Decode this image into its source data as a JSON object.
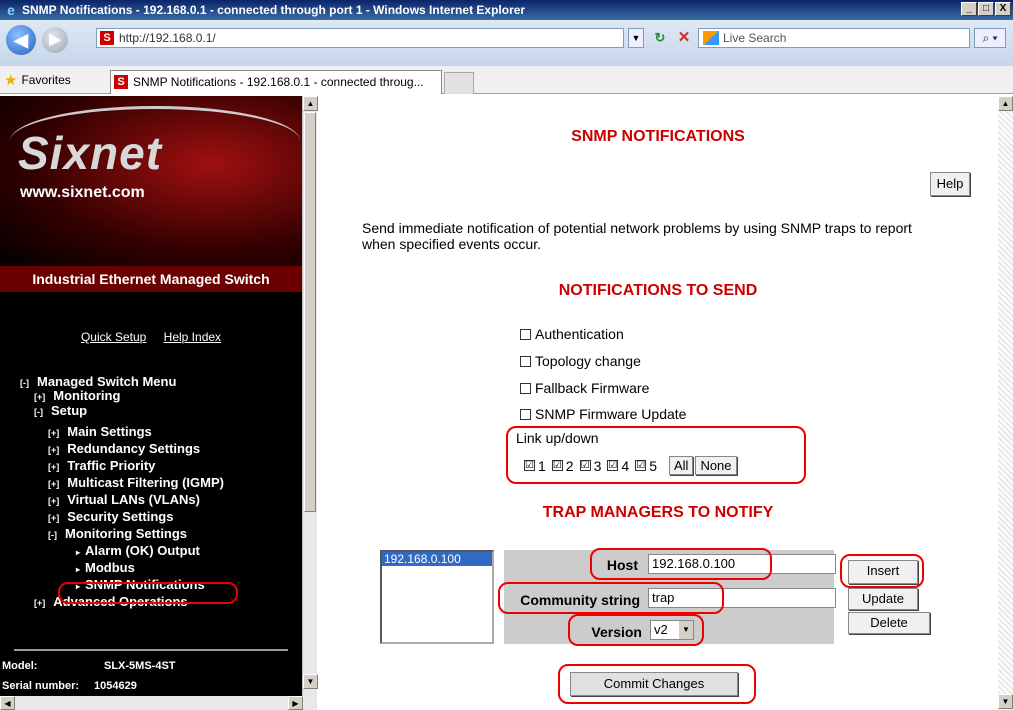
{
  "window": {
    "title": "SNMP Notifications - 192.168.0.1 - connected through port 1 - Windows Internet Explorer",
    "min": "_",
    "max": "□",
    "close": "X"
  },
  "browser": {
    "address": "http://192.168.0.1/",
    "search_placeholder": "Live Search",
    "favorites": "Favorites",
    "tab": "SNMP Notifications - 192.168.0.1 - connected throug..."
  },
  "sidebar": {
    "logo": "Sixnet",
    "url": "www.sixnet.com",
    "product": "Industrial Ethernet Managed Switch",
    "quick_setup": "Quick Setup",
    "help_index": "Help Index",
    "menu": [
      {
        "tog": "[-]",
        "label": "Managed Switch Menu"
      },
      {
        "tog": "[+]",
        "label": "Monitoring"
      },
      {
        "tog": "[-]",
        "label": "Setup"
      },
      {
        "tog": "[+]",
        "label": "Main Settings"
      },
      {
        "tog": "[+]",
        "label": "Redundancy Settings"
      },
      {
        "tog": "[+]",
        "label": "Traffic Priority"
      },
      {
        "tog": "[+]",
        "label": "Multicast Filtering (IGMP)"
      },
      {
        "tog": "[+]",
        "label": "Virtual LANs (VLANs)"
      },
      {
        "tog": "[+]",
        "label": "Security Settings"
      },
      {
        "tog": "[-]",
        "label": "Monitoring Settings"
      },
      {
        "tog": "▸",
        "label": "Alarm (OK) Output"
      },
      {
        "tog": "▸",
        "label": "Modbus"
      },
      {
        "tog": "▸",
        "label": "SNMP Notifications"
      },
      {
        "tog": "[+]",
        "label": "Advanced Operations"
      }
    ],
    "model_label": "Model:",
    "model": "SLX-5MS-4ST",
    "serial_label": "Serial number:",
    "serial": "1054629"
  },
  "main": {
    "title": "SNMP NOTIFICATIONS",
    "help": "Help",
    "description": "Send immediate notification of potential network problems by using SNMP traps to report when specified events occur.",
    "notifications_heading": "NOTIFICATIONS TO SEND",
    "notifications": [
      {
        "label": "Authentication",
        "checked": false
      },
      {
        "label": "Topology change",
        "checked": false
      },
      {
        "label": "Fallback Firmware",
        "checked": false
      },
      {
        "label": "SNMP Firmware Update",
        "checked": false
      }
    ],
    "link_label": "Link up/down",
    "ports": [
      "1",
      "2",
      "3",
      "4",
      "5"
    ],
    "check_mark": "☑",
    "all": "All",
    "none": "None",
    "trap_heading": "TRAP MANAGERS TO NOTIFY",
    "managers": [
      "192.168.0.100"
    ],
    "host_label": "Host",
    "host_value": "192.168.0.100",
    "community_label": "Community string",
    "community_value": "trap",
    "version_label": "Version",
    "version_value": "v2",
    "insert": "Insert",
    "update": "Update",
    "delete": "Delete",
    "commit": "Commit Changes"
  }
}
